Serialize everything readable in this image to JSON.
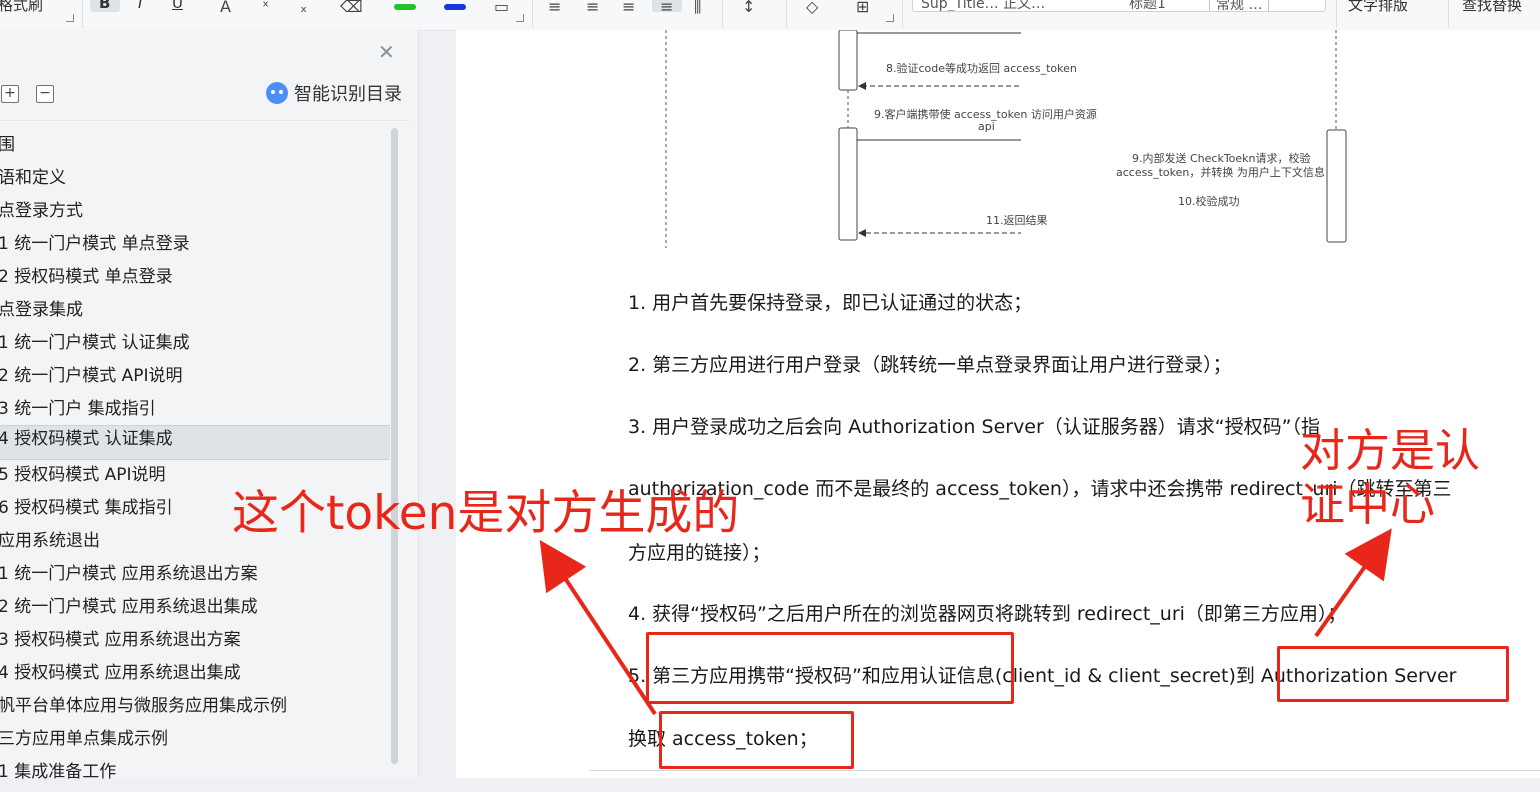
{
  "toolbar": {
    "left_text": "格式刷",
    "bold": "B",
    "italic": "I",
    "underline": "U",
    "style_dropdown": "Sup_Title…  正文…",
    "style_heading": "标题1",
    "style_normal": "常规 …",
    "right_a": "文字排版",
    "right_b": "查找替换"
  },
  "sidebar": {
    "smart_toc_label": "智能识别目录",
    "expand_label": "+",
    "collapse_label": "−",
    "items": [
      {
        "label": "围"
      },
      {
        "label": "语和定义"
      },
      {
        "label": "点登录方式"
      },
      {
        "label": "1  统一门户模式  单点登录"
      },
      {
        "label": "2  授权码模式  单点登录"
      },
      {
        "label": "点登录集成"
      },
      {
        "label": "1  统一门户模式  认证集成"
      },
      {
        "label": "2  统一门户模式  API说明"
      },
      {
        "label": "3  统一门户  集成指引"
      },
      {
        "label": "4  授权码模式  认证集成"
      },
      {
        "label": "5  授权码模式  API说明"
      },
      {
        "label": "6  授权码模式  集成指引"
      },
      {
        "label": "应用系统退出"
      },
      {
        "label": "1    统一门户模式  应用系统退出方案"
      },
      {
        "label": "2  统一门户模式  应用系统退出集成"
      },
      {
        "label": "3    授权码模式  应用系统退出方案"
      },
      {
        "label": "4    授权码模式  应用系统退出集成"
      },
      {
        "label": "帆平台单体应用与微服务应用集成示例"
      },
      {
        "label": "三方应用单点集成示例"
      },
      {
        "label": "1  集成准备工作"
      }
    ]
  },
  "diagram": {
    "step8": "8.验证code等成功返回 access_token",
    "step9a": "9.客户端携带使 access_token 访问用户资源",
    "step9b": "api",
    "step9c": "9.内部发送 CheckToekn请求，校验",
    "step9d": "access_token，并转换 为用户上下文信息",
    "step10": "10.校验成功",
    "step11": "11.返回结果"
  },
  "document": {
    "p1": "1. 用户首先要保持登录，即已认证通过的状态；",
    "p2": "2. 第三方应用进行用户登录（跳转统一单点登录界面让用户进行登录）；",
    "p3": "3. 用户登录成功之后会向 Authorization Server（认证服务器）请求“授权码”（指",
    "p3b": "authorization_code 而不是最终的 access_token），请求中还会携带 redirect_uri（跳转至第三",
    "p3c": "方应用的链接）；",
    "p4": "4. 获得“授权码”之后用户所在的浏览器网页将跳转到 redirect_uri（即第三方应用）；",
    "p5": "5. 第三方应用携带“授权码”和应用认证信息(client_id & client_secret)到 Authorization Server",
    "p5b": "换取 access_token；"
  },
  "annotations": {
    "token_note": "这个token是对方生成的",
    "server_note_line1": "对方是认",
    "server_note_line2": "证中心",
    "color": "#e8261a"
  }
}
